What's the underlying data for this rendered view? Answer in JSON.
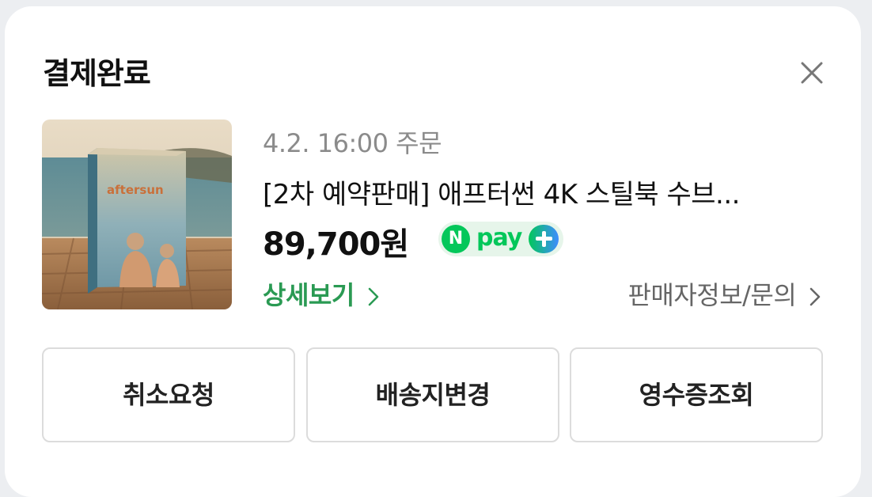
{
  "dialog": {
    "title": "결제완료"
  },
  "order": {
    "date_label": "4.2. 16:00 주문",
    "product_name": "[2차 예약판매] 애프터썬 4K 스틸북 수브...",
    "price": "89,700원",
    "payment_badge": {
      "n_letter": "N",
      "pay_text": "pay"
    },
    "detail_link": "상세보기",
    "seller_link": "판매자정보/문의",
    "thumbnail_text": "aftersun"
  },
  "actions": {
    "cancel_request": "취소요청",
    "change_address": "배송지변경",
    "view_receipt": "영수증조회"
  },
  "colors": {
    "accent_green": "#03c75a",
    "link_green": "#2a9a53",
    "npay_blue": "#3f8cff"
  },
  "icons": {
    "close": "close-icon",
    "chevron": "chevron-right-icon"
  }
}
